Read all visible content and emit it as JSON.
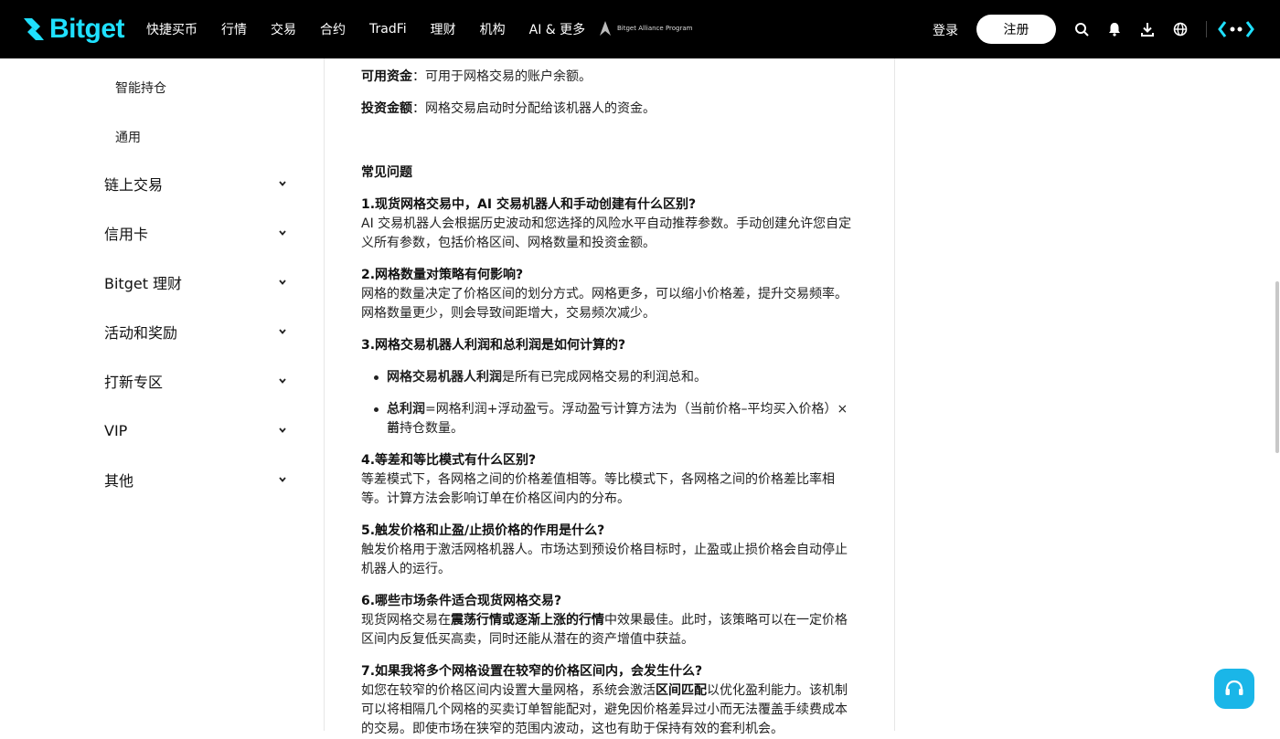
{
  "nav": {
    "brand": "Bitget",
    "items": [
      "快捷买币",
      "行情",
      "交易",
      "合约",
      "TradFi",
      "理财",
      "机构",
      "AI & 更多"
    ],
    "alliance_text": "Bitget Alliance Program",
    "login": "登录",
    "register": "注册",
    "icons": [
      "search-icon",
      "bell-icon",
      "download-icon",
      "globe-icon",
      "brand-mark-icon"
    ]
  },
  "sidebar": {
    "sub_items": [
      "智能持仓",
      "通用"
    ],
    "groups": [
      "链上交易",
      "信用卡",
      "Bitget 理财",
      "活动和奖励",
      "打新专区",
      "VIP",
      "其他"
    ]
  },
  "article": {
    "def1": {
      "term": "可用资金",
      "sep": "：",
      "desc": "可用于网格交易的账户余额。"
    },
    "def2": {
      "term": "投资金额",
      "sep": "：",
      "desc": "网格交易启动时分配给该机器人的资金。"
    },
    "faq_title": "常见问题",
    "q1": {
      "q": "1.现货网格交易中，AI 交易机器人和手动创建有什么区别?",
      "l1": "AI 交易机器人会根据历史波动和您选择的风险水平自动推荐参数。手动创建允许您自定",
      "l2": "义所有参数，包括价格区间、网格数量和投资金额。"
    },
    "q2": {
      "q": "2.网格数量对策略有何影响?",
      "l1": "网格的数量决定了价格区间的划分方式。网格更多，可以缩小价格差，提升交易频率。",
      "l2": "网格数量更少，则会导致间距增大，交易频次减少。"
    },
    "q3": {
      "q": "3.网格交易机器人利润和总利润是如何计算的?",
      "b1_bold": "网格交易机器人利润",
      "b1_rest": "是所有已完成网格交易的利润总和。",
      "b2_bold": "总利润",
      "b2_l1": "=网格利润+浮动盈亏。浮动盈亏计算方法为（当前价格–平均买入价格）×当",
      "b2_l2": "前持仓数量。"
    },
    "q4": {
      "q": "4.等差和等比模式有什么区别?",
      "l1": "等差模式下，各网格之间的价格差值相等。等比模式下，各网格之间的价格差比率相",
      "l2": "等。计算方法会影响订单在价格区间内的分布。"
    },
    "q5": {
      "q": "5.触发价格和止盈/止损价格的作用是什么?",
      "l1": "触发价格用于激活网格机器人。市场达到预设价格目标时，止盈或止损价格会自动停止",
      "l2": "机器人的运行。"
    },
    "q6": {
      "q": "6.哪些市场条件适合现货网格交易?",
      "l1_pre": "现货网格交易在",
      "l1_bold": "震荡行情或逐渐上涨的行情",
      "l1_post": "中效果最佳。此时，该策略可以在一定价格",
      "l2": "区间内反复低买高卖，同时还能从潜在的资产增值中获益。"
    },
    "q7": {
      "q": "7.如果我将多个网格设置在较窄的价格区间内，会发生什么?",
      "l1_pre": "如您在较窄的价格区间内设置大量网格，系统会激活",
      "l1_bold": "区间匹配",
      "l1_post": "以优化盈利能力。该机制",
      "l2": "可以将相隔几个网格的买卖订单智能配对，避免因价格差异过小而无法覆盖手续费成本",
      "l3": "的交易。即使市场在狭窄的范围内波动，这也有助于保持有效的套利机会。"
    }
  },
  "colors": {
    "brand": "#1fe0ff",
    "support": "#1ab6e8",
    "nav_bg": "#000000"
  }
}
